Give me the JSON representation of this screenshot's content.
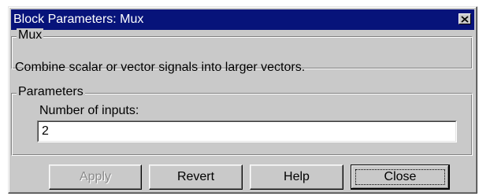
{
  "window": {
    "title": "Block Parameters: Mux",
    "close_icon": "close-icon"
  },
  "mux_group": {
    "legend": "Mux",
    "description": "Combine scalar or vector signals into larger vectors."
  },
  "params_group": {
    "legend": "Parameters",
    "number_of_inputs_label": "Number of inputs:",
    "number_of_inputs_value": "2"
  },
  "buttons": {
    "apply": "Apply",
    "revert": "Revert",
    "help": "Help",
    "close": "Close"
  },
  "colors": {
    "titlebar": "#07137a",
    "dialog_bg": "#c9c9c9",
    "disabled_text": "#8a8a8a"
  }
}
